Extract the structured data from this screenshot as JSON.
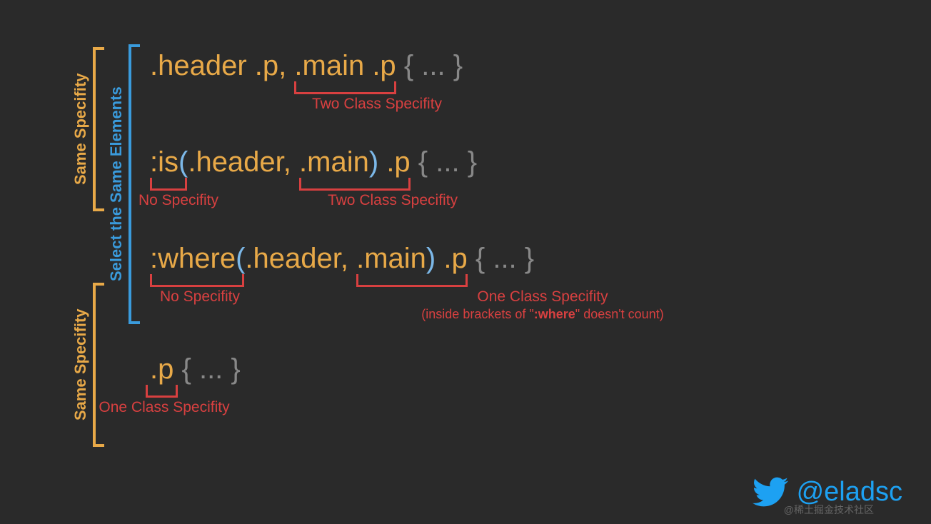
{
  "brackets": {
    "same_spec_top": "Same Specifity",
    "select_same": "Select the Same Elements",
    "same_spec_bottom": "Same Specifity"
  },
  "line1": {
    "prefix": ".header .p",
    "comma": ",",
    "highlight": ".main .p",
    "brace": "{ ... }",
    "anno": "Two Class Specifity"
  },
  "line2": {
    "fn": ":is",
    "open": "(",
    "arg1": ".header",
    "comma": ",",
    "arg2": ".main",
    "close": ")",
    "sel": ".p",
    "brace": "{ ... }",
    "anno1": "No Specifity",
    "anno2": "Two Class Specifity"
  },
  "line3": {
    "fn": ":where",
    "open": "(",
    "arg1": ".header",
    "comma": ",",
    "arg2": ".main",
    "close": ")",
    "sel": ".p",
    "brace": "{ ... }",
    "anno1": "No Specifity",
    "anno2": "One Class Specifity",
    "anno2sub_a": "(inside brackets  of \"",
    "anno2sub_b": ":where",
    "anno2sub_c": "\" doesn't count)"
  },
  "line4": {
    "sel": ".p",
    "brace": "{ ... }",
    "anno": "One Class Specifity"
  },
  "twitter": "@eladsc",
  "watermark": "@稀土掘金技术社区"
}
